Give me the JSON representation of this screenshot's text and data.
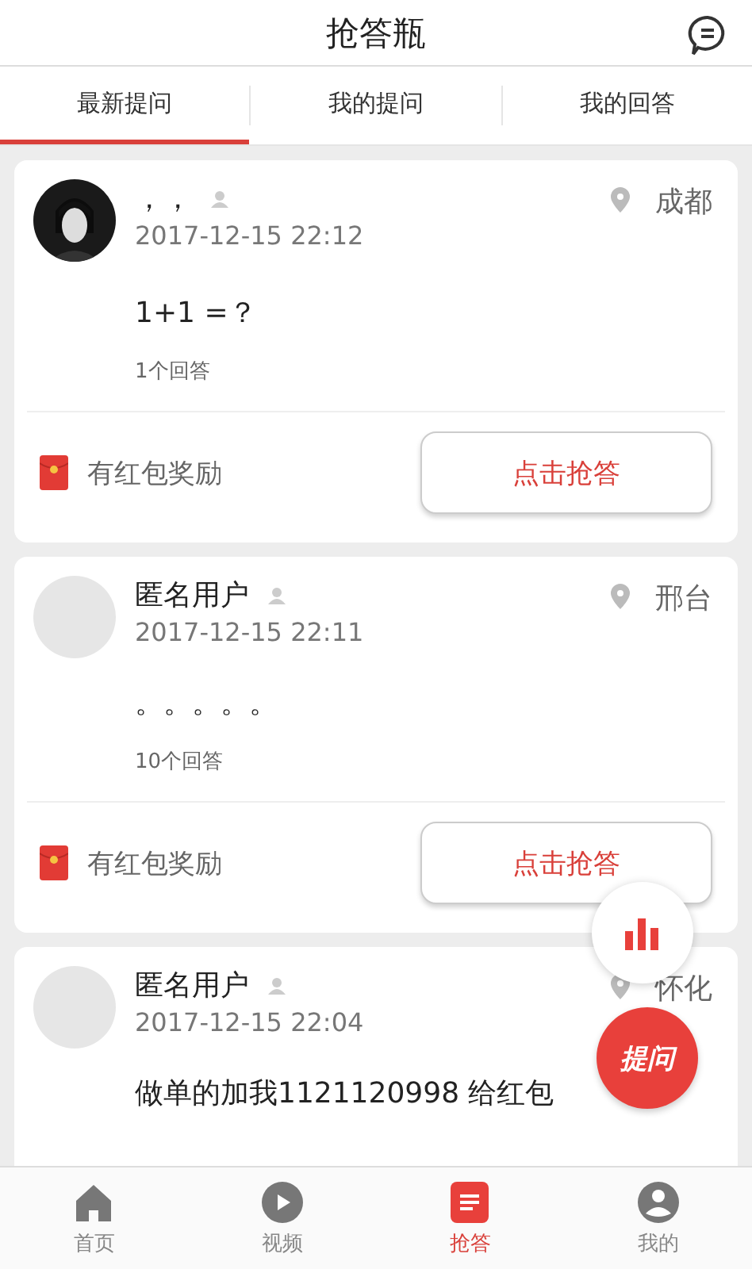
{
  "header": {
    "title": "抢答瓶"
  },
  "tabs": [
    {
      "label": "最新提问",
      "selected": true
    },
    {
      "label": "我的提问",
      "selected": false
    },
    {
      "label": "我的回答",
      "selected": false
    }
  ],
  "questions": [
    {
      "user": "，，",
      "time": "2017-12-15 22:12",
      "location": "成都",
      "question": "1+1 =？",
      "answers": "1个回答",
      "reward": "有红包奖励",
      "button": "点击抢答"
    },
    {
      "avatar": {
        "kind": "blank"
      },
      "user": "匿名用户",
      "time": "2017-12-15 22:11",
      "location": "邢台",
      "question": "。。。。。",
      "answers": "10个回答",
      "reward": "有红包奖励",
      "button": "点击抢答"
    },
    {
      "avatar": {
        "kind": "blank"
      },
      "user": "匿名用户",
      "time": "2017-12-15 22:04",
      "location": "怀化",
      "question": "做单的加我1121120998 给红包"
    }
  ],
  "fab": {
    "label": "提问"
  },
  "nav": [
    {
      "label": "首页",
      "selected": false
    },
    {
      "label": "视频",
      "selected": false
    },
    {
      "label": "抢答",
      "selected": true
    },
    {
      "label": "我的",
      "selected": false
    }
  ]
}
